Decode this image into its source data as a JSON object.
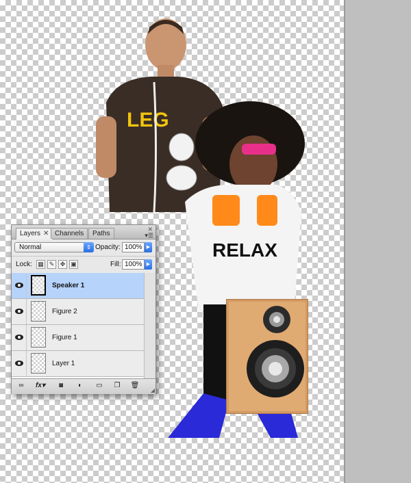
{
  "panel": {
    "tabs": [
      "Layers",
      "Channels",
      "Paths"
    ],
    "active_tab": "Layers",
    "blend_mode": "Normal",
    "opacity_label": "Opacity:",
    "opacity_value": "100%",
    "lock_label": "Lock:",
    "fill_label": "Fill:",
    "fill_value": "100%",
    "layers": [
      {
        "name": "Speaker 1",
        "selected": true,
        "visible": true
      },
      {
        "name": "Figure 2",
        "selected": false,
        "visible": true
      },
      {
        "name": "Figure 1",
        "selected": false,
        "visible": true
      },
      {
        "name": "Layer 1",
        "selected": false,
        "visible": true
      }
    ],
    "bottom_icons": [
      "link-icon",
      "fx-icon",
      "mask-icon",
      "adjustment-icon",
      "folder-icon",
      "new-layer-icon",
      "trash-icon"
    ],
    "fx_label": "fx"
  },
  "colors": {
    "selection": "#b6d3fb",
    "accent_blue": "#2a6fe0",
    "canvas_checker": "#cccccc",
    "pasteboard": "#bfbfbf"
  }
}
